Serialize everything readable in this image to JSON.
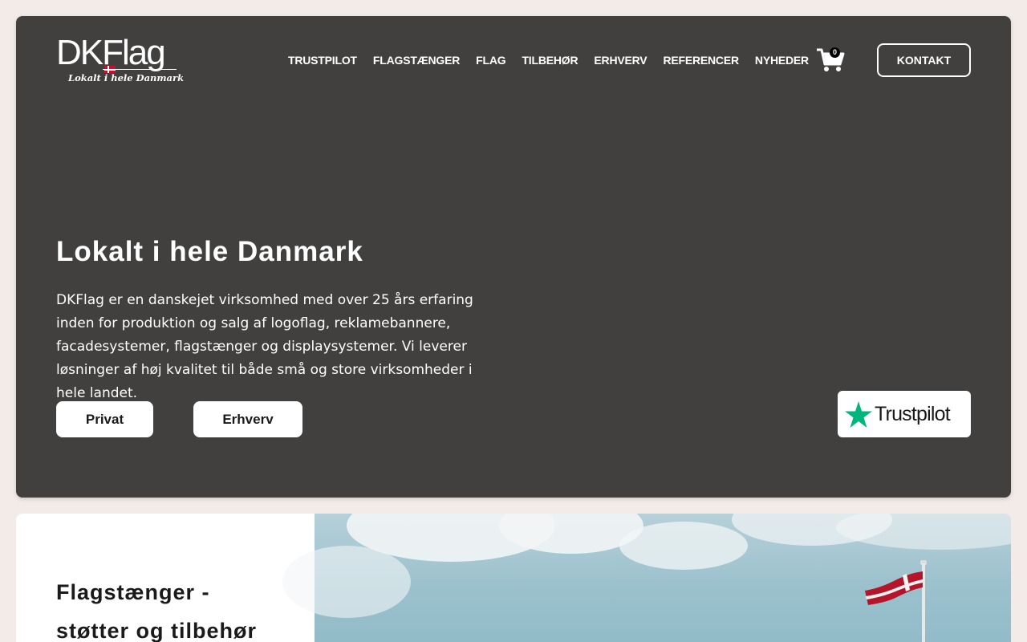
{
  "header": {
    "logo_text": "DKFlag",
    "logo_tagline": "Lokalt i hele Danmark",
    "nav": [
      {
        "label": "TRUSTPILOT"
      },
      {
        "label": "FLAGSTÆNGER"
      },
      {
        "label": "FLAG"
      },
      {
        "label": "TILBEHØR"
      },
      {
        "label": "ERHVERV"
      },
      {
        "label": "REFERENCER"
      },
      {
        "label": "NYHEDER"
      }
    ],
    "cart_count": "0",
    "contact_label": "KONTAKT"
  },
  "hero": {
    "title": "Lokalt i hele Danmark",
    "text": "DKFlag er en danskejet virksomhed med over 25 års erfaring inden for produktion og salg af logoflag, reklamebannere, facadesystemer, flagstænger og displaysystemer. Vi leverer løsninger af høj kvalitet til både små og store virksomheder i hele landet.",
    "btn_private": "Privat",
    "btn_business": "Erhverv",
    "trustpilot_label": "Trustpilot"
  },
  "section2": {
    "title": "Flagstænger - støtter og tilbehør"
  },
  "colors": {
    "hero_bg": "#42403f",
    "page_bg": "#f3ebe8",
    "trustpilot_green": "#00b67a",
    "danish_red": "#c8102e"
  }
}
